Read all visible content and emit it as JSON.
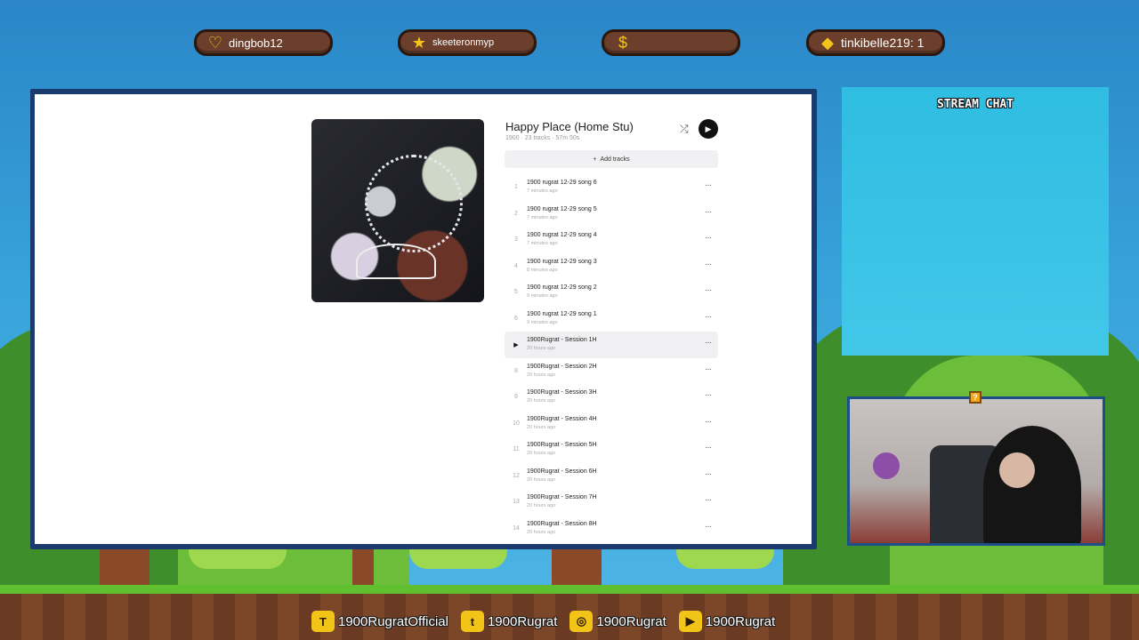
{
  "alerts": [
    {
      "icon": "heart-icon",
      "glyph": "♡",
      "label": "dingbob12"
    },
    {
      "icon": "star-icon",
      "glyph": "★",
      "label": "skeeteronmyp"
    },
    {
      "icon": "money-bag-icon",
      "glyph": "$",
      "label": ""
    },
    {
      "icon": "diamond-icon",
      "glyph": "◆",
      "label": "tinkibelle219: 1"
    }
  ],
  "playlist": {
    "title": "Happy Place (Home Stu)",
    "subtitle": "1900 · 23 tracks · 57m 50s",
    "add_tracks_label": "Add tracks",
    "tracks": [
      {
        "num": "1",
        "name": "1900 rugrat 12-29 song 6",
        "time": "7 minutes ago"
      },
      {
        "num": "2",
        "name": "1900 rugrat 12-29 song 5",
        "time": "7 minutes ago"
      },
      {
        "num": "3",
        "name": "1900 rugrat 12-29 song 4",
        "time": "7 minutes ago"
      },
      {
        "num": "4",
        "name": "1900 rugrat 12-29 song 3",
        "time": "8 minutes ago"
      },
      {
        "num": "5",
        "name": "1900 rugrat 12-29 song 2",
        "time": "9 minutes ago"
      },
      {
        "num": "6",
        "name": "1900 rugrat 12-29 song 1",
        "time": "9 minutes ago"
      },
      {
        "num": "▶",
        "name": "1900Rugrat - Session 1H",
        "time": "20 hours ago",
        "active": true
      },
      {
        "num": "8",
        "name": "1900Rugrat - Session 2H",
        "time": "20 hours ago"
      },
      {
        "num": "9",
        "name": "1900Rugrat - Session 3H",
        "time": "20 hours ago"
      },
      {
        "num": "10",
        "name": "1900Rugrat - Session 4H",
        "time": "20 hours ago"
      },
      {
        "num": "11",
        "name": "1900Rugrat - Session 5H",
        "time": "20 hours ago"
      },
      {
        "num": "12",
        "name": "1900Rugrat - Session 6H",
        "time": "20 hours ago"
      },
      {
        "num": "13",
        "name": "1900Rugrat - Session 7H",
        "time": "20 hours ago"
      },
      {
        "num": "14",
        "name": "1900Rugrat - Session 8H",
        "time": "20 hours ago"
      }
    ]
  },
  "chat": {
    "title": "STREAM CHAT"
  },
  "socials": [
    {
      "icon": "twitch-icon",
      "glyph": "T",
      "handle": "1900RugratOfficial"
    },
    {
      "icon": "twitter-icon",
      "glyph": "t",
      "handle": "1900Rugrat"
    },
    {
      "icon": "instagram-icon",
      "glyph": "◎",
      "handle": "1900Rugrat"
    },
    {
      "icon": "youtube-icon",
      "glyph": "▶",
      "handle": "1900Rugrat"
    }
  ]
}
